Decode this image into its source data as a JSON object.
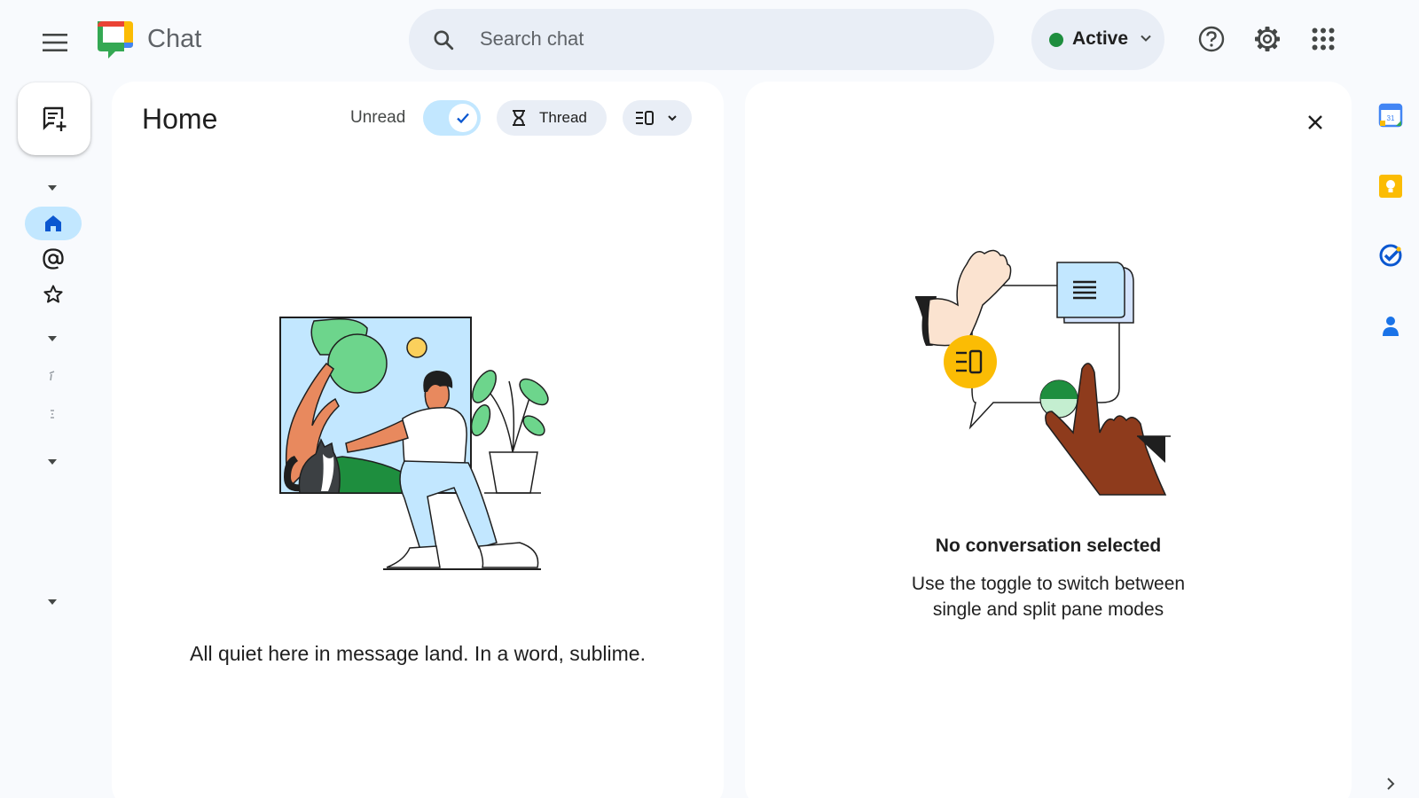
{
  "app": {
    "title": "Chat"
  },
  "search": {
    "placeholder": "Search chat"
  },
  "status": {
    "label": "Active",
    "color": "#1e8e3e"
  },
  "header_icons": [
    "menu-icon",
    "help-icon",
    "gear-icon",
    "apps-grid-icon"
  ],
  "home": {
    "title": "Home",
    "unread_label": "Unread",
    "unread_toggle_on": true,
    "thread_label": "Thread",
    "empty_message": "All quiet here in message land. In a word, sublime."
  },
  "detail": {
    "title": "No conversation selected",
    "subtitle": "Use the toggle to switch between single and split pane modes"
  },
  "side_apps": [
    "calendar-icon",
    "keep-icon",
    "tasks-icon",
    "contacts-icon"
  ],
  "colors": {
    "accent": "#c2e7ff",
    "background": "#f8fafd",
    "chip": "#e9eef6"
  }
}
